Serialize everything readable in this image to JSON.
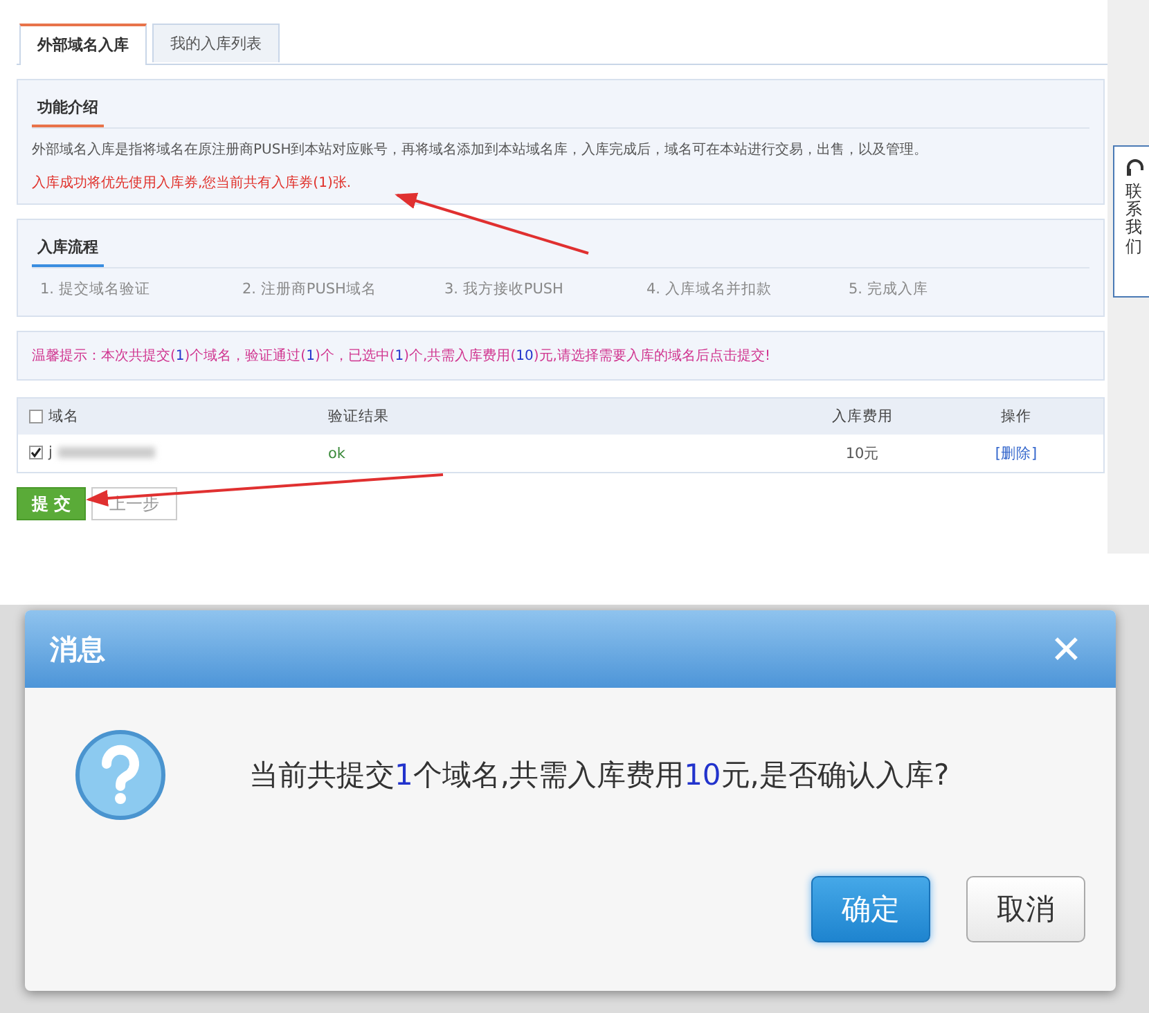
{
  "tabs": [
    {
      "label": "外部域名入库",
      "selected": true
    },
    {
      "label": "我的入库列表",
      "selected": false
    }
  ],
  "intro": {
    "title": "功能介绍",
    "description": "外部域名入库是指将域名在原注册商PUSH到本站对应账号，再将域名添加到本站域名库，入库完成后，域名可在本站进行交易，出售，以及管理。",
    "notice": "入库成功将优先使用入库券,您当前共有入库券(1)张."
  },
  "process": {
    "title": "入库流程",
    "steps": [
      "1. 提交域名验证",
      "2. 注册商PUSH域名",
      "3. 我方接收PUSH",
      "4. 入库域名并扣款",
      "5. 完成入库"
    ]
  },
  "tip": [
    {
      "text": "温馨提示：本次共提交(",
      "highlight": false
    },
    {
      "text": "1",
      "highlight": true
    },
    {
      "text": ")个域名，验证通过(",
      "highlight": false
    },
    {
      "text": "1",
      "highlight": true
    },
    {
      "text": ")个，已选中(",
      "highlight": false
    },
    {
      "text": "1",
      "highlight": true
    },
    {
      "text": ")个,共需入库费用(",
      "highlight": false
    },
    {
      "text": "10",
      "highlight": true
    },
    {
      "text": ")元,请选择需要入库的域名后点击提交!",
      "highlight": false
    }
  ],
  "table": {
    "select_all_checked": false,
    "columns": [
      "域名",
      "验证结果",
      "入库费用",
      "操作"
    ],
    "rows": [
      {
        "checked": true,
        "domain": "j",
        "result": "ok",
        "fee": "10元",
        "action": "[删除]"
      }
    ]
  },
  "buttons": {
    "submit": "提 交",
    "back": "上一步"
  },
  "contact": {
    "label": "联系我们"
  },
  "dialog": {
    "title": "消息",
    "close": "✕",
    "message": [
      {
        "text": "当前共提交",
        "highlight": false
      },
      {
        "text": "1",
        "highlight": true
      },
      {
        "text": "个域名,共需入库费用",
        "highlight": false
      },
      {
        "text": "10",
        "highlight": true
      },
      {
        "text": "元,是否确认入库?",
        "highlight": false
      }
    ],
    "ok": "确定",
    "cancel": "取消"
  }
}
